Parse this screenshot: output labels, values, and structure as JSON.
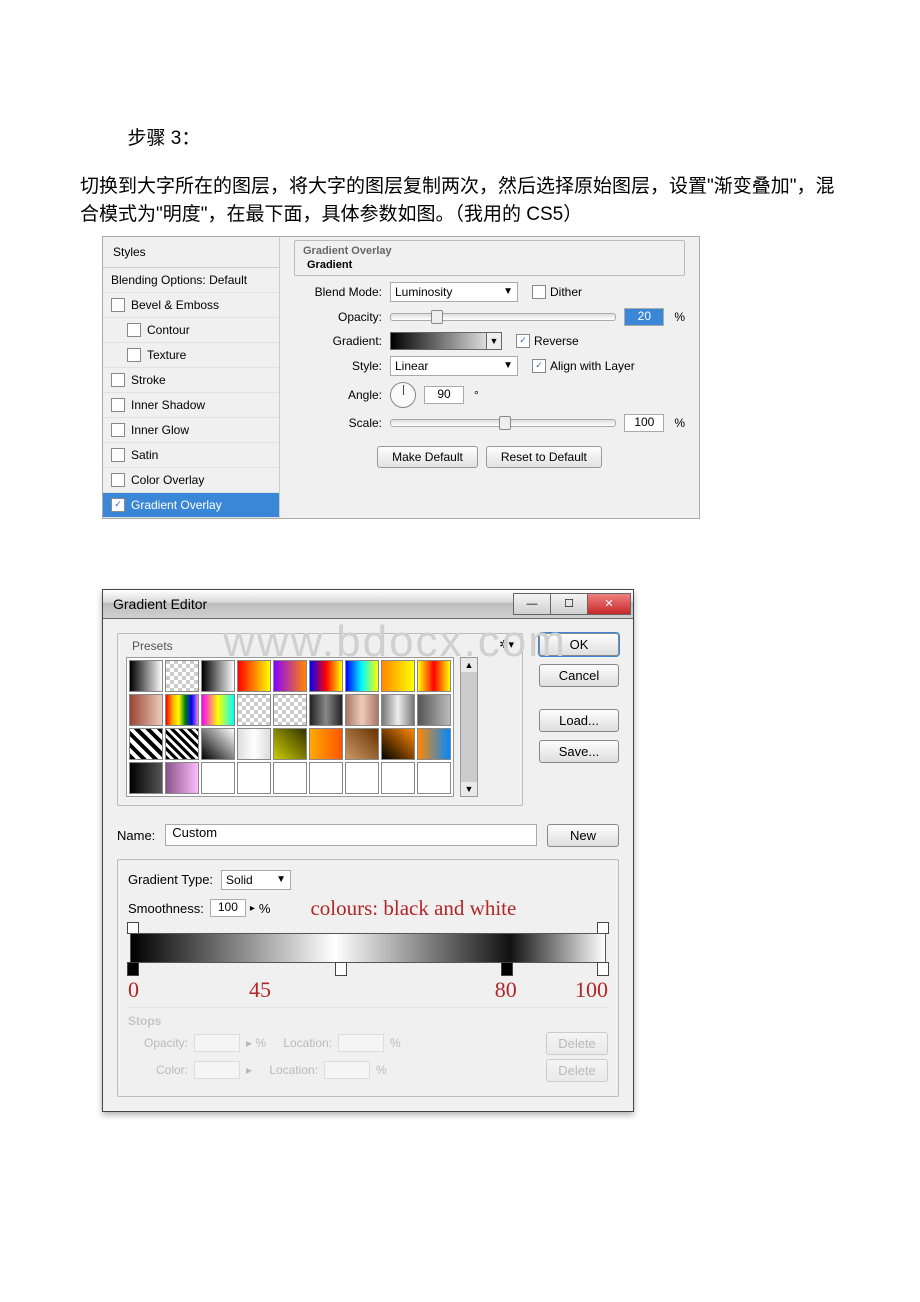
{
  "intro": {
    "line1": "步骤 3：",
    "line2": "切换到大字所在的图层，将大字的图层复制两次，然后选择原始图层，设置\"渐变叠加\"，混合模式为\"明度\"，在最下面，具体参数如图。（我用的 CS5）"
  },
  "layerStyle": {
    "stylesHeader": "Styles",
    "blendingOptions": "Blending Options: Default",
    "items": [
      {
        "label": "Bevel & Emboss",
        "checked": false
      },
      {
        "label": "Contour",
        "checked": false,
        "sub": true
      },
      {
        "label": "Texture",
        "checked": false,
        "sub": true
      },
      {
        "label": "Stroke",
        "checked": false
      },
      {
        "label": "Inner Shadow",
        "checked": false
      },
      {
        "label": "Inner Glow",
        "checked": false
      },
      {
        "label": "Satin",
        "checked": false
      },
      {
        "label": "Color Overlay",
        "checked": false
      },
      {
        "label": "Gradient Overlay",
        "checked": true,
        "selected": true
      }
    ],
    "groupTitle1": "Gradient Overlay",
    "groupTitle2": "Gradient",
    "labels": {
      "blendMode": "Blend Mode:",
      "opacity": "Opacity:",
      "gradient": "Gradient:",
      "style": "Style:",
      "angle": "Angle:",
      "scale": "Scale:",
      "dither": "Dither",
      "reverse": "Reverse",
      "align": "Align with Layer",
      "makeDefault": "Make Default",
      "resetDefault": "Reset to Default",
      "pct": "%",
      "deg": "°"
    },
    "values": {
      "blendMode": "Luminosity",
      "opacity": "20",
      "style": "Linear",
      "angle": "90",
      "scale": "100",
      "dither": false,
      "reverse": true,
      "align": true
    }
  },
  "gradientEditor": {
    "title": "Gradient Editor",
    "presetsLabel": "Presets",
    "gearIcon": "gear-icon",
    "buttons": {
      "ok": "OK",
      "cancel": "Cancel",
      "load": "Load...",
      "save": "Save...",
      "new": "New",
      "delete": "Delete"
    },
    "nameLabel": "Name:",
    "nameValue": "Custom",
    "gradientTypeLabel": "Gradient Type:",
    "gradientTypeValue": "Solid",
    "smoothnessLabel": "Smoothness:",
    "smoothnessValue": "100",
    "pct": "%",
    "annotation": "colours: black and white",
    "stopPositions": [
      "0",
      "45",
      "80",
      "100"
    ],
    "stopsLabel": "Stops",
    "opacityLabel": "Opacity:",
    "locationLabel": "Location:",
    "colorLabel": "Color:",
    "swatches": [
      "linear-gradient(90deg,#000,#fff)",
      "repeating-conic-gradient(#ccc 0 25%,#fff 0 50%) 0/8px 8px",
      "linear-gradient(90deg,#000,#fff)",
      "linear-gradient(90deg,#f00,#ff0)",
      "linear-gradient(90deg,#80f,#f80)",
      "linear-gradient(90deg,#00f,#f00,#ff0)",
      "linear-gradient(90deg,#00f,#0ff,#ff0)",
      "linear-gradient(90deg,#f80,#ff0)",
      "linear-gradient(90deg,#ff0,#f00,#ff0)",
      "linear-gradient(90deg,#943,#ecb)",
      "linear-gradient(90deg,red,orange,yellow,green,blue,violet)",
      "linear-gradient(90deg,#f0f,#ff0,#0ff)",
      "repeating-conic-gradient(#ccc 0 25%,#fff 0 50%) 0/8px 8px",
      "repeating-conic-gradient(#ccc 0 25%,#fff 0 50%) 0/8px 8px",
      "linear-gradient(90deg,#222,#888,#222)",
      "linear-gradient(90deg,#a76,#ecb,#a76)",
      "linear-gradient(90deg,#777,#eee,#777)",
      "linear-gradient(90deg,#555,#bbb)",
      "repeating-linear-gradient(45deg,#000 0 4px,#fff 4px 8px)",
      "repeating-linear-gradient(45deg,#000 0 3px,#fff 3px 6px)",
      "linear-gradient(45deg,#000,#fff)",
      "linear-gradient(90deg,#ddd,#fff,#ddd)",
      "linear-gradient(45deg,#cc0,#330)",
      "linear-gradient(90deg,#fa0,#f50)",
      "linear-gradient(45deg,#c96,#630)",
      "linear-gradient(45deg,#000,#f80)",
      "linear-gradient(90deg,#f80,#08f)",
      "linear-gradient(90deg,#000,#555)",
      "linear-gradient(90deg,#858,#fbf)",
      "linear-gradient(90deg,#fff,#fff)",
      "linear-gradient(90deg,#fff,#fff)",
      "linear-gradient(90deg,#fff,#fff)",
      "linear-gradient(90deg,#fff,#fff)",
      "linear-gradient(90deg,#fff,#fff)",
      "linear-gradient(90deg,#fff,#fff)",
      "linear-gradient(90deg,#fff,#fff)"
    ]
  },
  "watermark": "www.bdocx.com"
}
